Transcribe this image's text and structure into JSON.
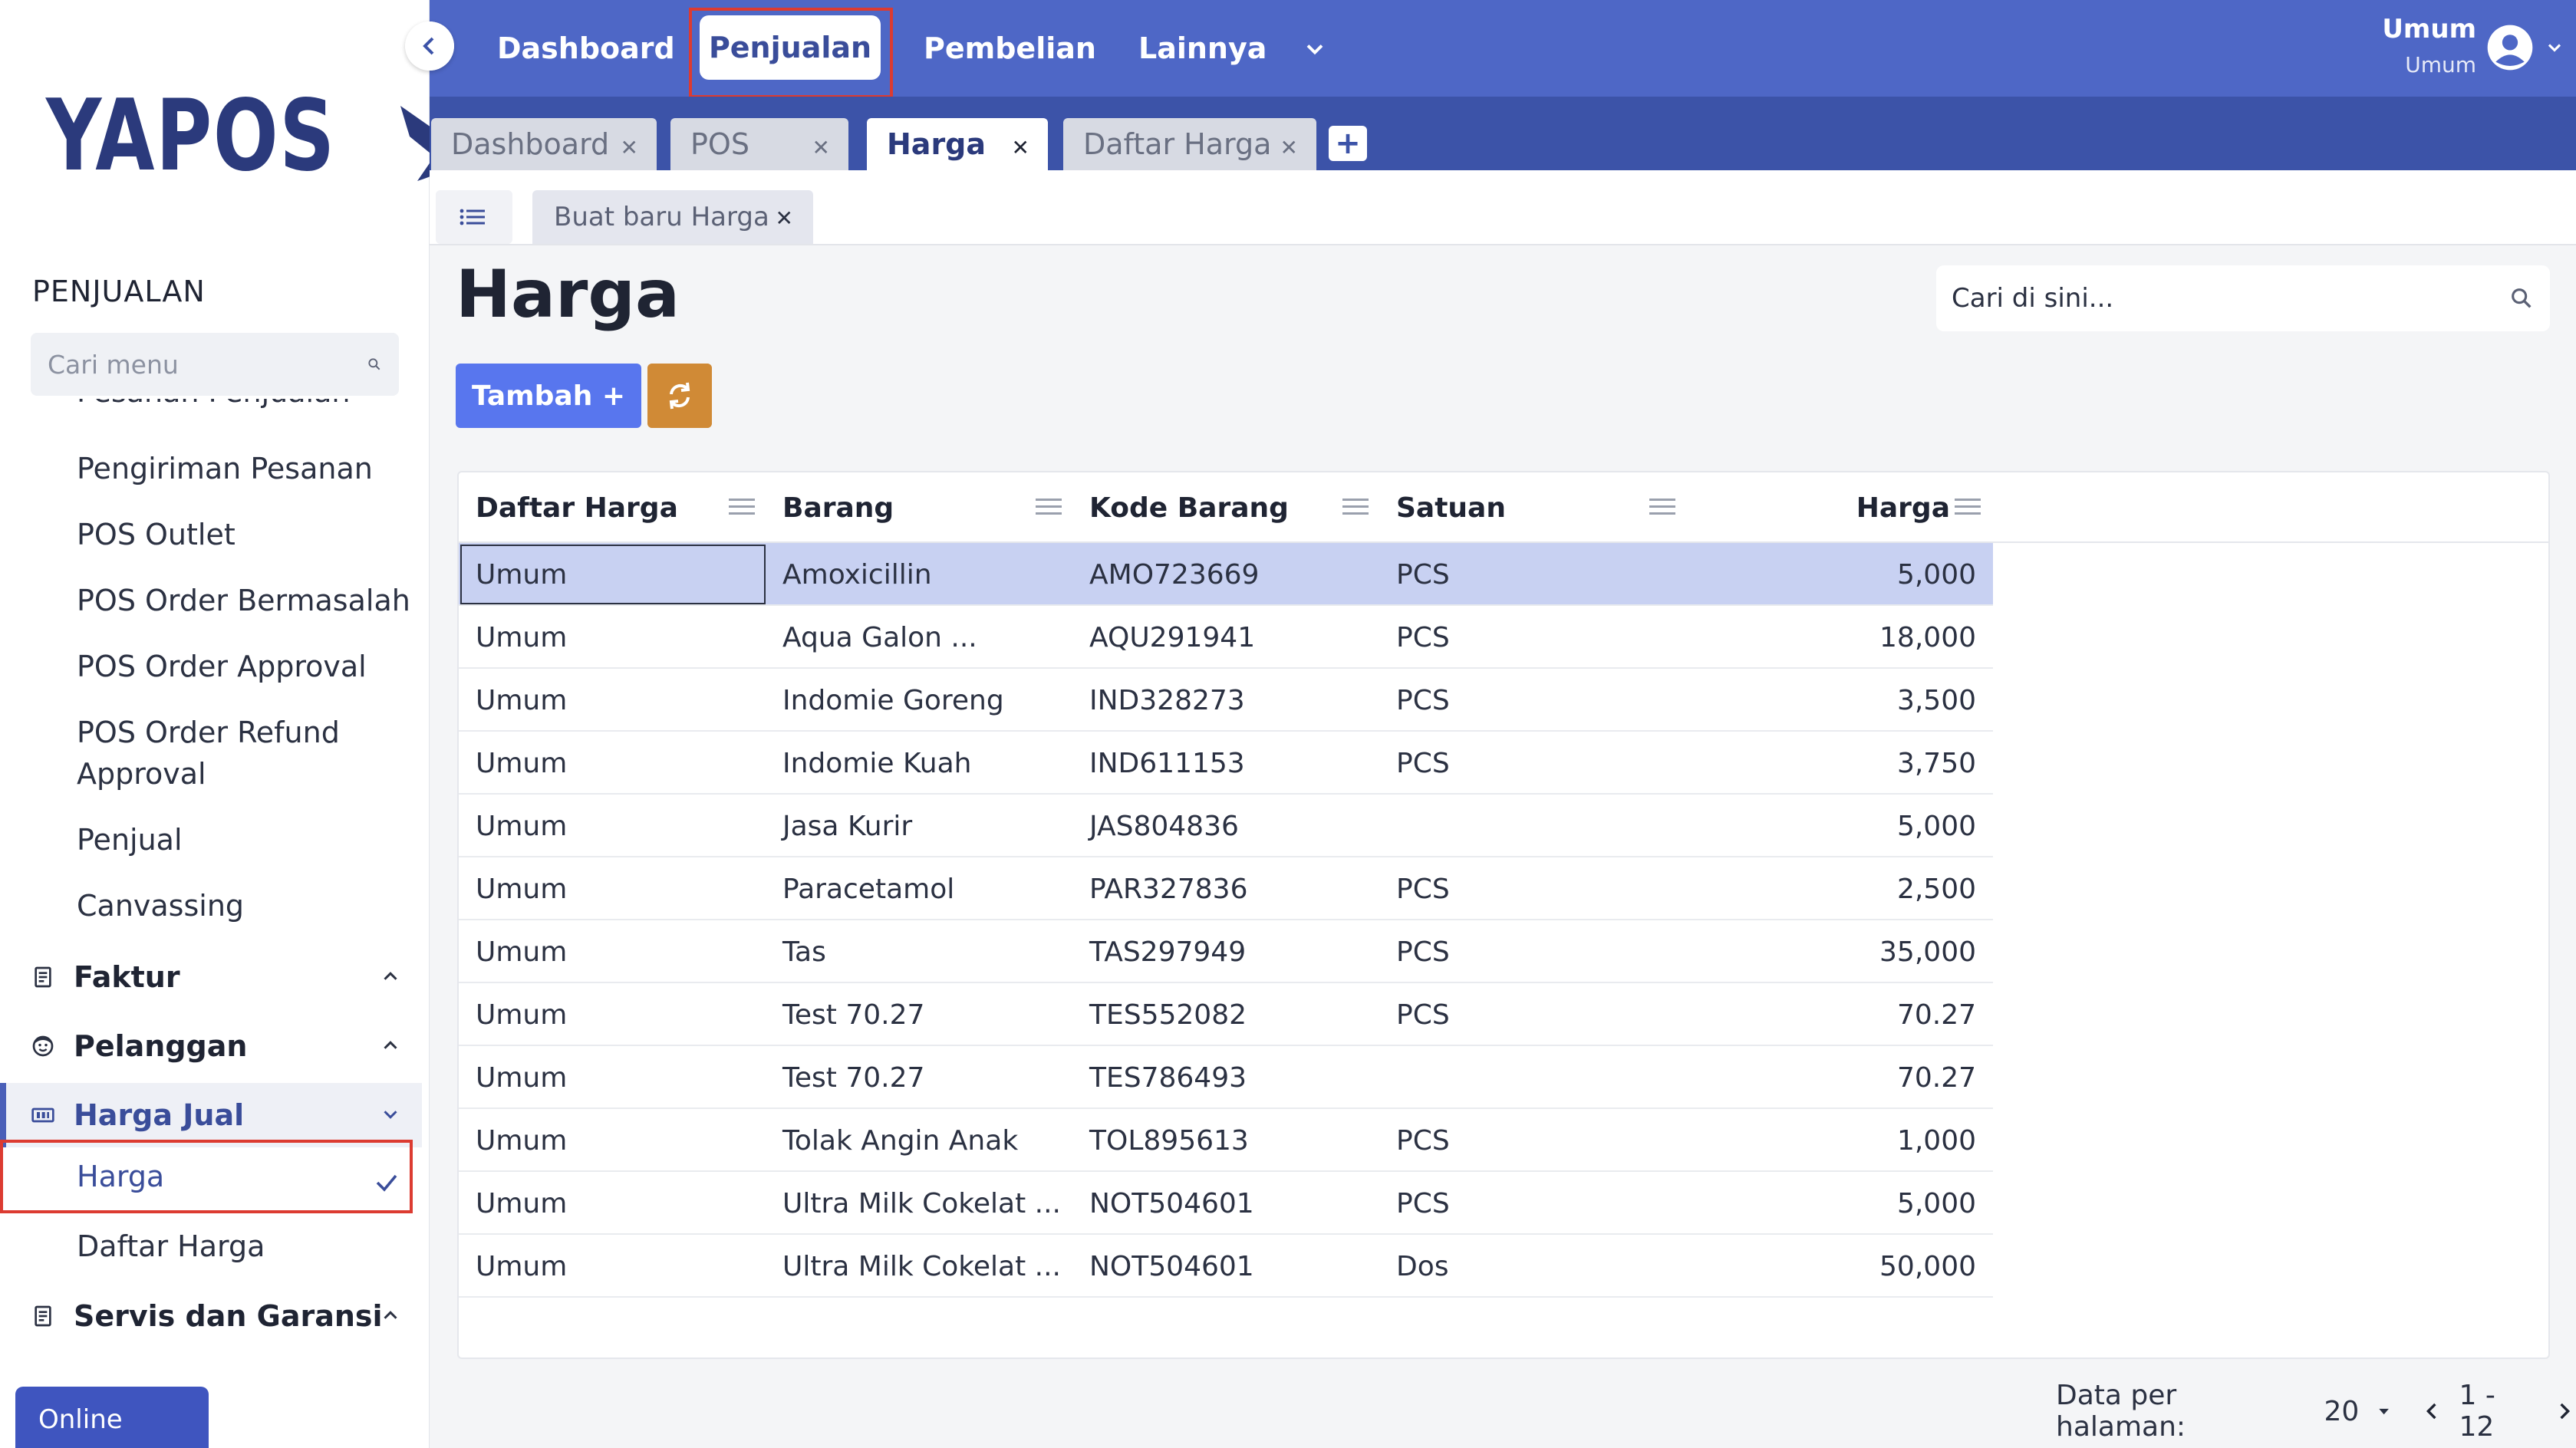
{
  "app": {
    "logo_text": "YAPOS"
  },
  "sidebar": {
    "section_title": "PENJUALAN",
    "search_placeholder": "Cari menu",
    "partial_item": "Pesanan Penjualan",
    "sub_items": [
      "Pengiriman Pesanan",
      "POS Outlet",
      "POS Order Bermasalah",
      "POS Order Approval",
      "POS Order Refund",
      "Approval",
      "Penjual",
      "Canvassing"
    ],
    "groups": {
      "faktur": "Faktur",
      "pelanggan": "Pelanggan",
      "harga_jual": "Harga Jual",
      "servis": "Servis dan Garansi"
    },
    "harga_jual_items": {
      "harga": "Harga",
      "daftar_harga": "Daftar Harga"
    },
    "online_label": "Online"
  },
  "topnav": {
    "items": [
      "Dashboard",
      "Penjualan",
      "Pembelian",
      "Lainnya"
    ],
    "active": "Penjualan",
    "user_name": "Umum",
    "user_role": "Umum"
  },
  "tabs": [
    "Dashboard",
    "POS",
    "Harga",
    "Daftar Harga"
  ],
  "active_tab": "Harga",
  "subtab": "Buat baru Harga",
  "page": {
    "title": "Harga",
    "search_placeholder": "Cari di sini...",
    "add_button": "Tambah +"
  },
  "table": {
    "columns": [
      "Daftar Harga",
      "Barang",
      "Kode Barang",
      "Satuan",
      "Harga"
    ],
    "rows": [
      [
        "Umum",
        "Amoxicillin",
        "AMO723669",
        "PCS",
        "5,000"
      ],
      [
        "Umum",
        "Aqua Galon ...",
        "AQU291941",
        "PCS",
        "18,000"
      ],
      [
        "Umum",
        "Indomie Goreng",
        "IND328273",
        "PCS",
        "3,500"
      ],
      [
        "Umum",
        "Indomie Kuah",
        "IND611153",
        "PCS",
        "3,750"
      ],
      [
        "Umum",
        "Jasa Kurir",
        "JAS804836",
        "",
        "5,000"
      ],
      [
        "Umum",
        "Paracetamol",
        "PAR327836",
        "PCS",
        "2,500"
      ],
      [
        "Umum",
        "Tas",
        "TAS297949",
        "PCS",
        "35,000"
      ],
      [
        "Umum",
        "Test 70.27",
        "TES552082",
        "PCS",
        "70.27"
      ],
      [
        "Umum",
        "Test 70.27",
        "TES786493",
        "",
        "70.27"
      ],
      [
        "Umum",
        "Tolak Angin Anak",
        "TOL895613",
        "PCS",
        "1,000"
      ],
      [
        "Umum",
        "Ultra Milk Cokelat ...",
        "NOT504601",
        "PCS",
        "5,000"
      ],
      [
        "Umum",
        "Ultra Milk Cokelat ...",
        "NOT504601",
        "Dos",
        "50,000"
      ]
    ],
    "selected_row": 0
  },
  "pager": {
    "per_page_label": "Data per halaman:",
    "per_page_value": "20",
    "range": "1 - 12"
  },
  "colors": {
    "nav_bg": "#4e67c6",
    "tab_bar_bg": "#3c53a8",
    "accent": "#5876ee",
    "refresh": "#d08a36",
    "highlight": "#dc3b31",
    "selected_row": "#c8d1f2"
  }
}
